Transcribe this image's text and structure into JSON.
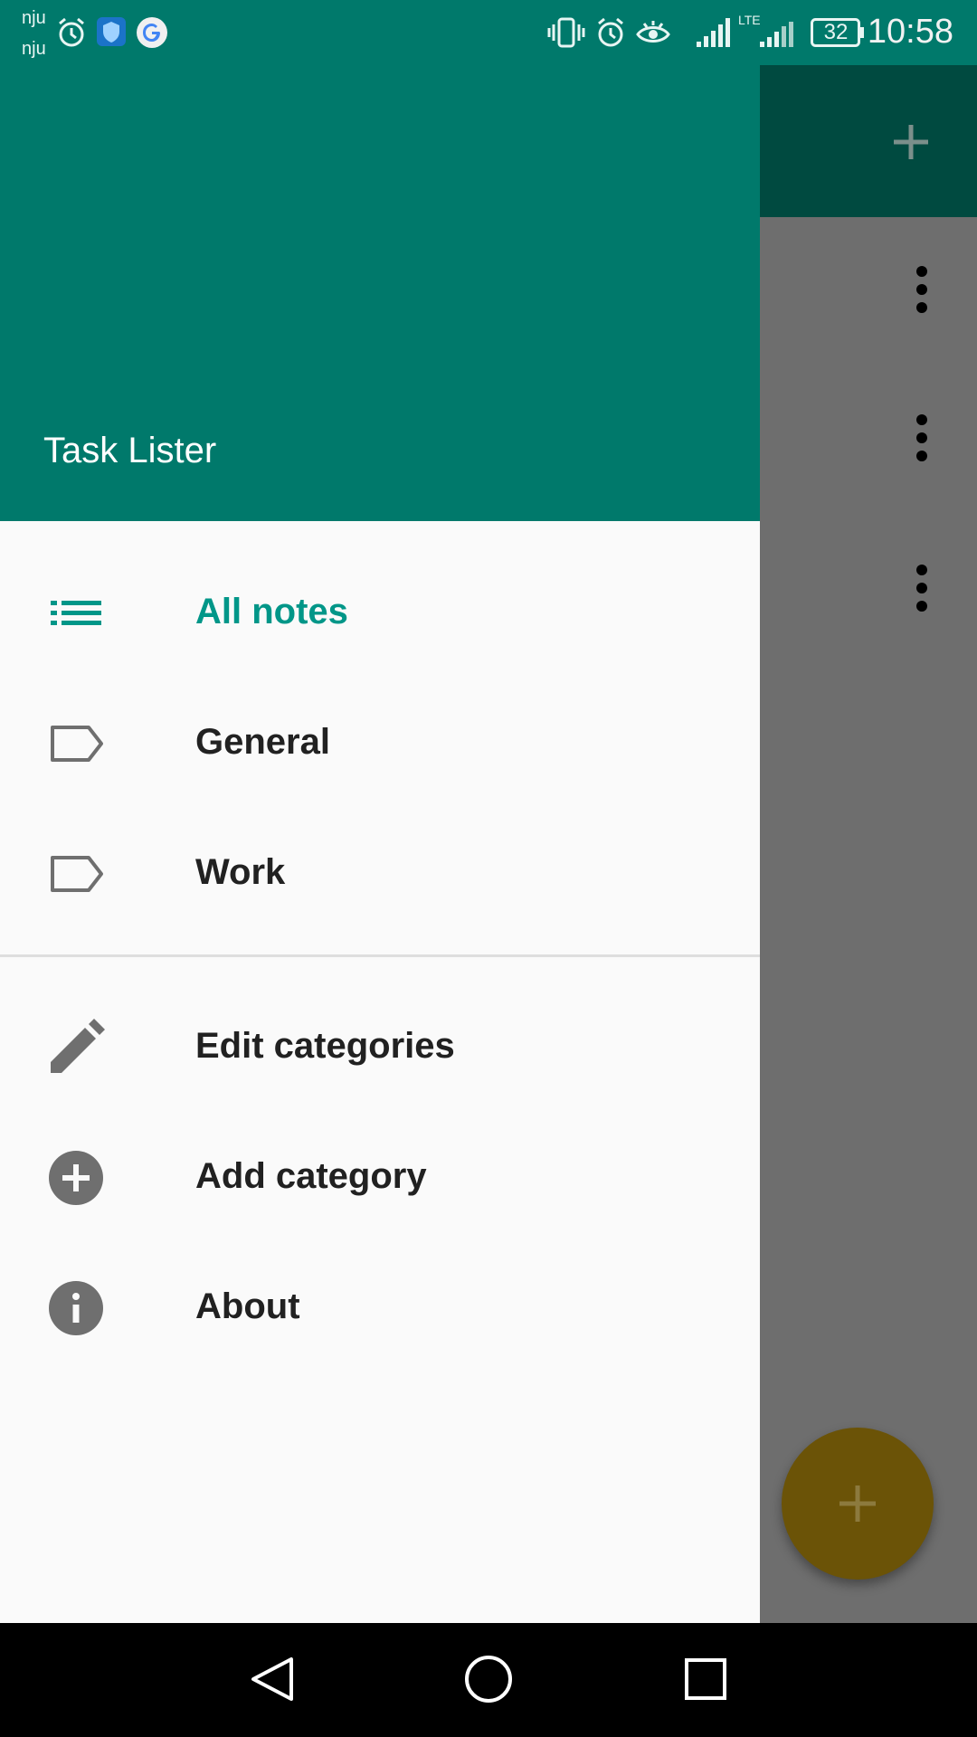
{
  "status_bar": {
    "carrier_line1": "nju",
    "carrier_line2": "nju",
    "network": "LTE",
    "battery": "32",
    "time": "10:58"
  },
  "drawer": {
    "app_title": "Task Lister",
    "items": [
      {
        "label": "All notes",
        "icon": "list-icon",
        "active": true
      },
      {
        "label": "General",
        "icon": "label-icon"
      },
      {
        "label": "Work",
        "icon": "label-icon"
      }
    ],
    "actions": [
      {
        "label": "Edit categories",
        "icon": "pencil-icon"
      },
      {
        "label": "Add category",
        "icon": "add-circle-icon"
      },
      {
        "label": "About",
        "icon": "info-icon"
      }
    ]
  },
  "colors": {
    "primary": "#00796b",
    "accent_text": "#009688",
    "drawer_bg": "#fafafa"
  }
}
